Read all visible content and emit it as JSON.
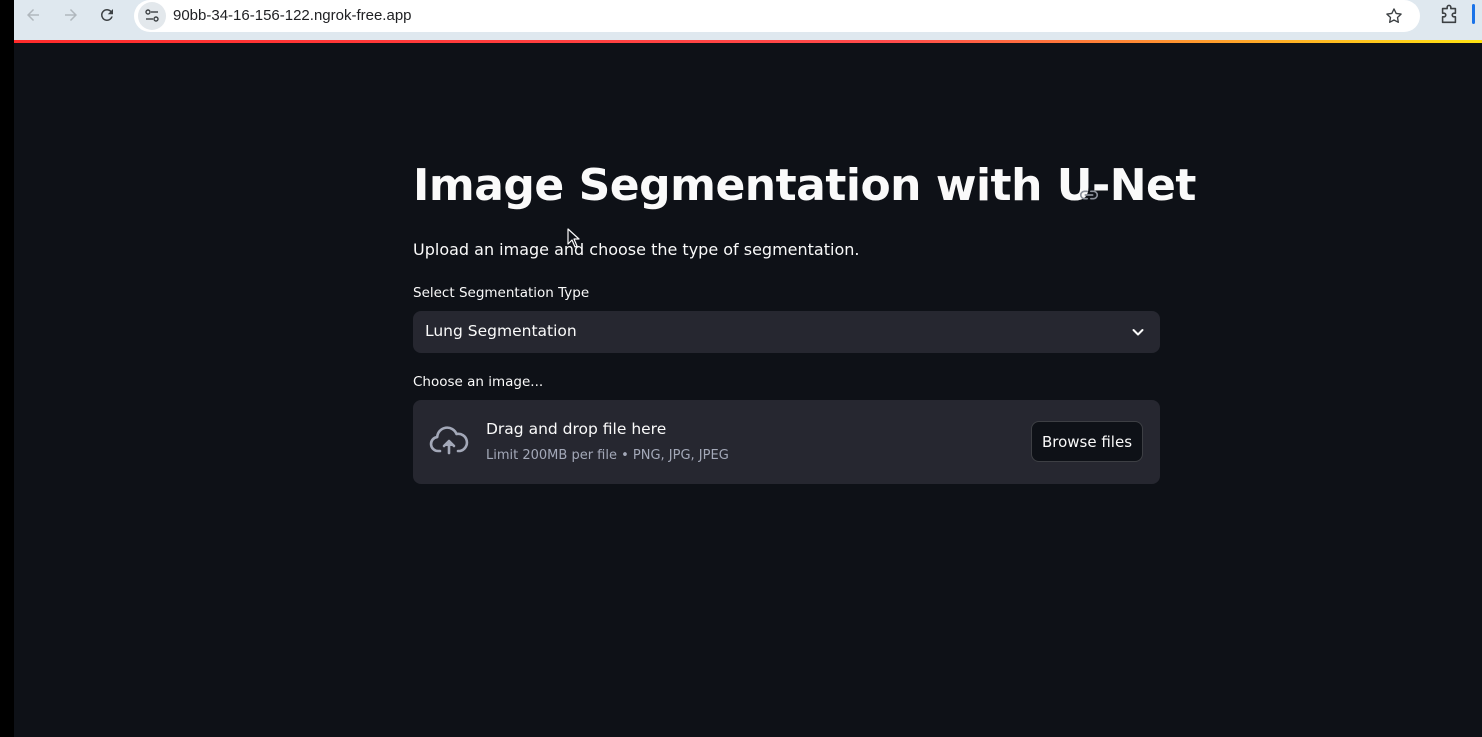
{
  "browser": {
    "url": "90bb-34-16-156-122.ngrok-free.app",
    "icons": [
      "back-icon",
      "forward-icon",
      "reload-icon",
      "site-info-icon",
      "star-icon",
      "extensions-icon"
    ]
  },
  "app": {
    "title": "Image Segmentation with U-Net",
    "subtitle": "Upload an image and choose the type of segmentation.",
    "select": {
      "label": "Select Segmentation Type",
      "value": "Lung Segmentation"
    },
    "uploader": {
      "label": "Choose an image...",
      "drop_title": "Drag and drop file here",
      "limit_text": "Limit 200MB per file • PNG, JPG, JPEG",
      "browse_label": "Browse files"
    }
  },
  "colors": {
    "background": "#0e1117",
    "widget_bg": "#262730",
    "text": "#fafafa",
    "muted_text": "#a3a8b8",
    "header_accent_start": "#ff2b2b",
    "header_accent_end": "#ffe312"
  }
}
